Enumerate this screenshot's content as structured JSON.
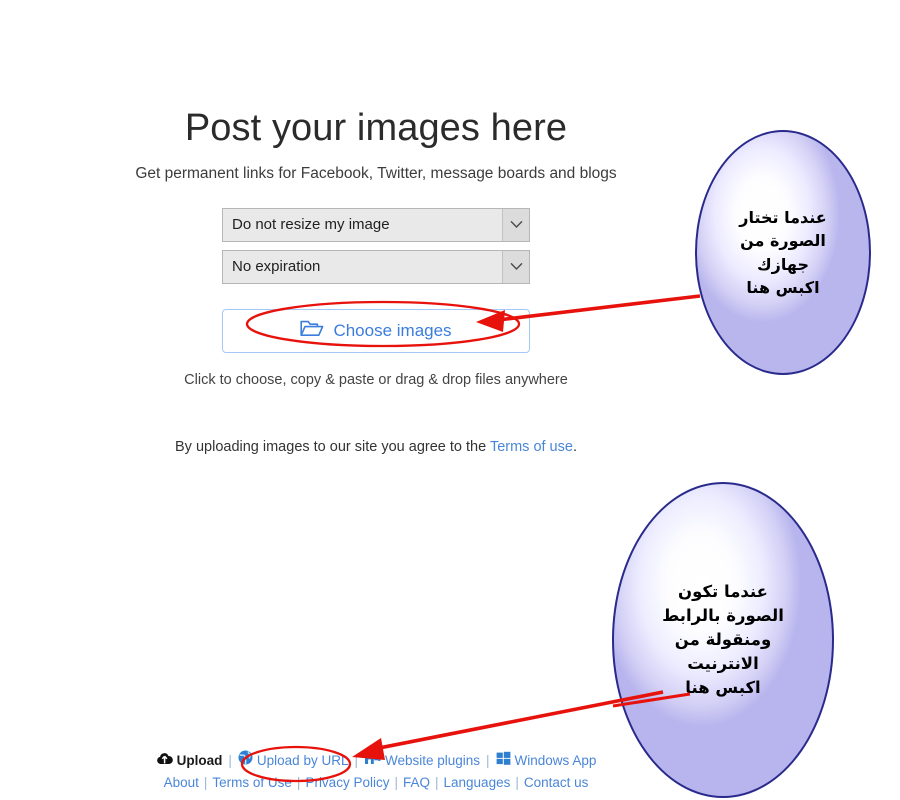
{
  "header": {
    "title": "Post your images here",
    "subtitle": "Get permanent links for Facebook, Twitter, message boards and blogs"
  },
  "form": {
    "resize_select": {
      "value": "Do not resize my image",
      "icon": "chevron-down-icon"
    },
    "expiration_select": {
      "value": "No expiration",
      "icon": "chevron-down-icon"
    },
    "choose_button": {
      "label": "Choose images",
      "icon": "folder-open-icon"
    },
    "hint": "Click to choose, copy & paste or drag & drop files anywhere"
  },
  "terms": {
    "prefix": "By uploading images to our site you agree to the ",
    "link": "Terms of use",
    "suffix": "."
  },
  "footer": {
    "row1": [
      {
        "label": "Upload",
        "icon": "cloud-upload-icon"
      },
      {
        "label": "Upload by URL",
        "icon": "globe-icon"
      },
      {
        "label": "Website plugins",
        "icon": "plugin-icon"
      },
      {
        "label": "Windows App",
        "icon": "windows-logo-icon"
      }
    ],
    "separator": "|",
    "row2": [
      "About",
      "Terms of Use",
      "Privacy Policy",
      "FAQ",
      "Languages",
      "Contact us"
    ]
  },
  "annotations": {
    "callout_top": {
      "lines": [
        "عندما تختار",
        "الصورة من",
        "جهازك",
        "اكبس هنا"
      ]
    },
    "callout_bottom": {
      "lines": [
        "عندما تكون",
        "الصورة بالرابط",
        "ومنقولة من",
        "الانترنيت",
        "اكبس هنا"
      ]
    },
    "marker_color": "#e8120c",
    "callout_border_color": "#2a2a8c"
  }
}
